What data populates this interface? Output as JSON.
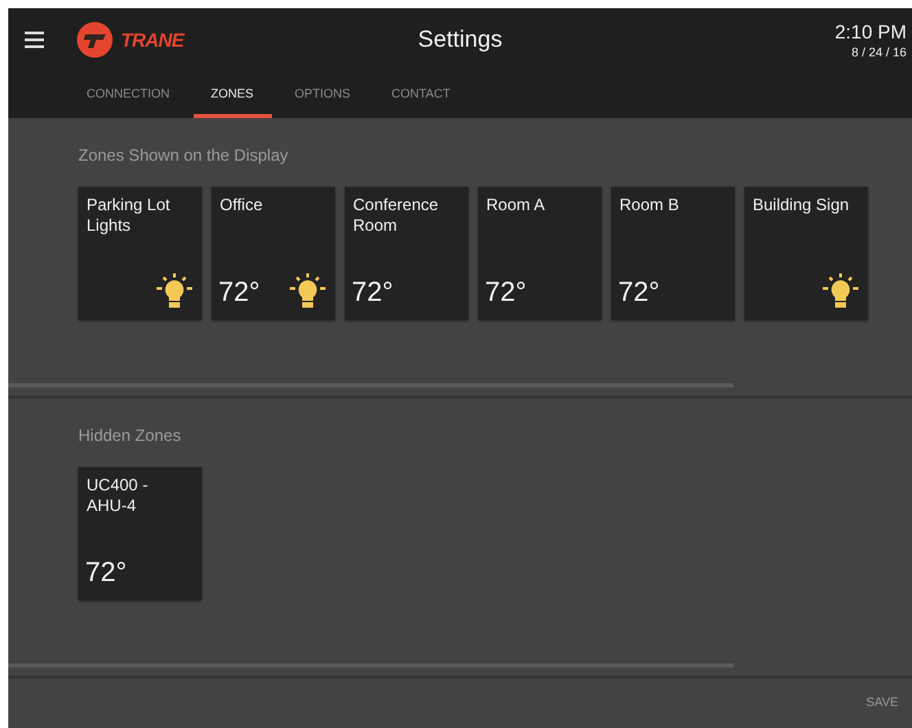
{
  "header": {
    "logo": "TRANE",
    "title": "Settings",
    "time": "2:10 PM",
    "date": "8 / 24 / 16"
  },
  "tabs": [
    {
      "label": "CONNECTION",
      "selected": false
    },
    {
      "label": "ZONES",
      "selected": true
    },
    {
      "label": "OPTIONS",
      "selected": false
    },
    {
      "label": "CONTACT",
      "selected": false
    }
  ],
  "sections": [
    {
      "title": "Zones Shown on the Display",
      "zones": [
        {
          "name": "Parking Lot Lights",
          "light": true
        },
        {
          "name": "Office",
          "temperature": "72°",
          "light": true
        },
        {
          "name": "Conference Room",
          "temperature": "72°",
          "light": false
        },
        {
          "name": "Room A",
          "temperature": "72°",
          "light": false
        },
        {
          "name": "Room B",
          "temperature": "72°",
          "light": false
        },
        {
          "name": "Building Sign",
          "light": true
        }
      ]
    },
    {
      "title": "Hidden Zones",
      "zones": [
        {
          "name": "UC400 - AHU-4",
          "temperature": "72°",
          "light": false
        }
      ]
    }
  ],
  "save_button": "SAVE"
}
